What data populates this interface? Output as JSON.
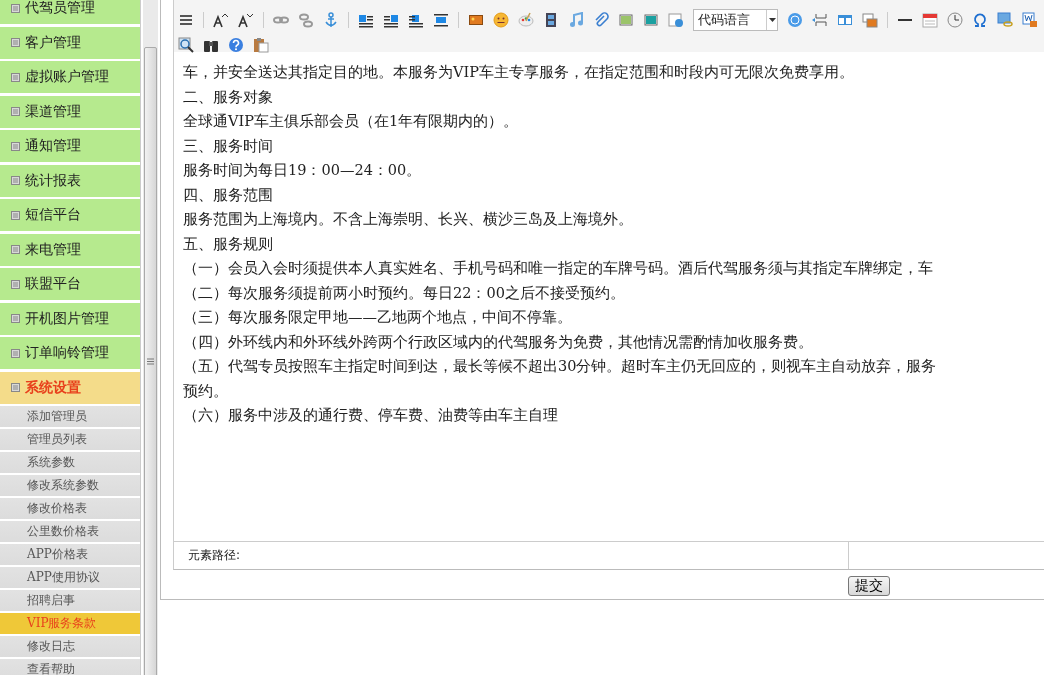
{
  "sidebar": {
    "menu": [
      {
        "label": "代驾员管理",
        "selected": false
      },
      {
        "label": "客户管理",
        "selected": false
      },
      {
        "label": "虚拟账户管理",
        "selected": false
      },
      {
        "label": "渠道管理",
        "selected": false
      },
      {
        "label": "通知管理",
        "selected": false
      },
      {
        "label": "统计报表",
        "selected": false
      },
      {
        "label": "短信平台",
        "selected": false
      },
      {
        "label": "来电管理",
        "selected": false
      },
      {
        "label": "联盟平台",
        "selected": false
      },
      {
        "label": "开机图片管理",
        "selected": false
      },
      {
        "label": "订单响铃管理",
        "selected": false
      },
      {
        "label": "系统设置",
        "selected": true,
        "children": [
          {
            "label": "添加管理员",
            "selected": false
          },
          {
            "label": "管理员列表",
            "selected": false
          },
          {
            "label": "系统参数",
            "selected": false
          },
          {
            "label": "修改系统参数",
            "selected": false
          },
          {
            "label": "修改价格表",
            "selected": false
          },
          {
            "label": "公里数价格表",
            "selected": false
          },
          {
            "label": "APP价格表",
            "selected": false
          },
          {
            "label": "APP使用协议",
            "selected": false
          },
          {
            "label": "招聘启事",
            "selected": false
          },
          {
            "label": "VIP服务条款",
            "selected": true
          },
          {
            "label": "修改日志",
            "selected": false
          },
          {
            "label": "查看帮助",
            "selected": false
          }
        ]
      }
    ]
  },
  "editor": {
    "toolbar": {
      "code_language_select": {
        "value": "代码语言"
      }
    },
    "lines": [
      "车，并安全送达其指定目的地。本服务为VIP车主专享服务，在指定范围和时段内可无限次免费享用。",
      "二、服务对象",
      "全球通VIP车主俱乐部会员（在1年有限期内的）。",
      "三、服务时间",
      "服务时间为每日19：00—24：00。",
      "四、服务范围",
      "服务范围为上海境内。不含上海崇明、长兴、横沙三岛及上海境外。",
      "五、服务规则",
      "（一）会员入会时须提供本人真实姓名、手机号码和唯一指定的车牌号码。酒后代驾服务须与其指定车牌绑定，车",
      "（二）每次服务须提前两小时预约。每日22：00之后不接受预约。",
      "（三）每次服务限定甲地——乙地两个地点，中间不停靠。",
      "（四）外环线内和外环线外跨两个行政区域内的代驾服务为免费，其他情况需酌情加收服务费。",
      "（五）代驾专员按照车主指定时间到达，最长等候不超出30分钟。超时车主仍无回应的，则视车主自动放弃，服务",
      "预约。",
      "（六）服务中涉及的通行费、停车费、油费等由车主自理"
    ],
    "status_bar": {
      "label": "元素路径:"
    }
  },
  "submit_button": {
    "label": "提交"
  }
}
